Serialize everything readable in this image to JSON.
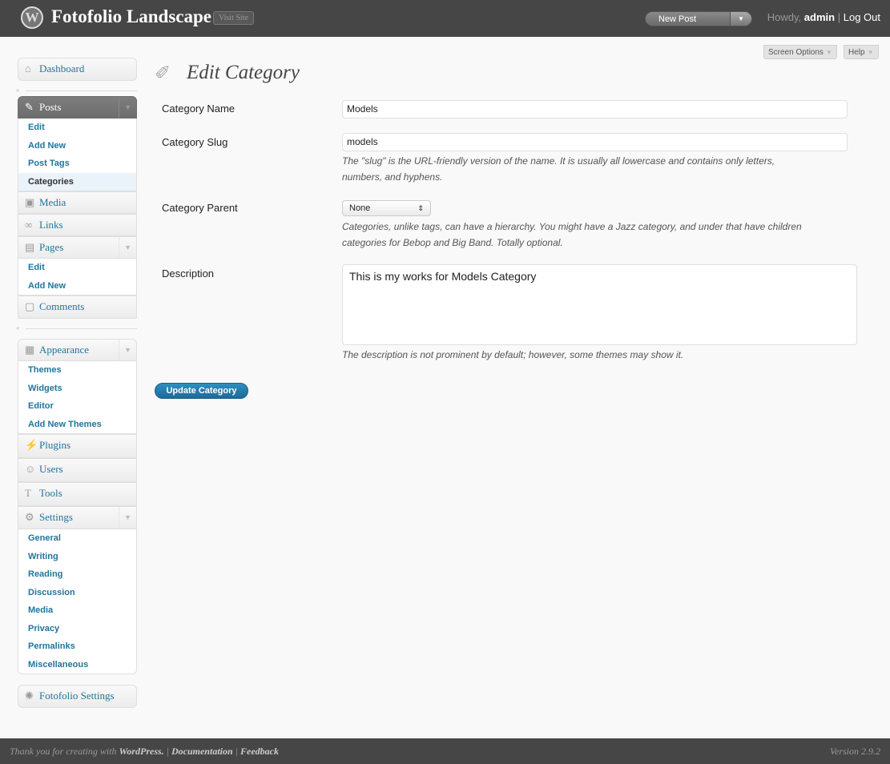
{
  "header": {
    "site_title": "Fotofolio Landscape",
    "visit_site": "Visit Site",
    "new_post": "New Post",
    "howdy_prefix": "Howdy,",
    "user": "admin",
    "separator": "|",
    "logout": "Log Out"
  },
  "screen_options": {
    "screen_options": "Screen Options",
    "help": "Help"
  },
  "sidebar": {
    "dashboard": "Dashboard",
    "posts": {
      "label": "Posts",
      "items": [
        "Edit",
        "Add New",
        "Post Tags",
        "Categories"
      ]
    },
    "media": "Media",
    "links": "Links",
    "pages": {
      "label": "Pages",
      "items": [
        "Edit",
        "Add New"
      ]
    },
    "comments": "Comments",
    "appearance": {
      "label": "Appearance",
      "items": [
        "Themes",
        "Widgets",
        "Editor",
        "Add New Themes"
      ]
    },
    "plugins": "Plugins",
    "users": "Users",
    "tools": "Tools",
    "settings": {
      "label": "Settings",
      "items": [
        "General",
        "Writing",
        "Reading",
        "Discussion",
        "Media",
        "Privacy",
        "Permalinks",
        "Miscellaneous"
      ]
    },
    "fotofolio_settings": "Fotofolio Settings"
  },
  "main": {
    "title": "Edit Category",
    "category_name": {
      "label": "Category Name",
      "value": "Models"
    },
    "category_slug": {
      "label": "Category Slug",
      "value": "models",
      "help_line1": "The \"slug\" is the URL-friendly version of the name. It is usually all lowercase and contains only letters,",
      "help_line2": "numbers, and hyphens."
    },
    "category_parent": {
      "label": "Category Parent",
      "value": "None",
      "help_line1": "Categories, unlike tags, can have a hierarchy. You might have a Jazz category, and under that have children",
      "help_line2": "categories for Bebop and Big Band. Totally optional."
    },
    "description": {
      "label": "Description",
      "value": "This is my works for Models Category",
      "help": "The description is not prominent by default; however, some themes may show it."
    },
    "update_button": "Update Category"
  },
  "footer": {
    "thanks_prefix": "Thank you for creating with",
    "wordpress": "WordPress.",
    "sep": "|",
    "documentation": "Documentation",
    "feedback": "Feedback",
    "version": "Version 2.9.2"
  }
}
